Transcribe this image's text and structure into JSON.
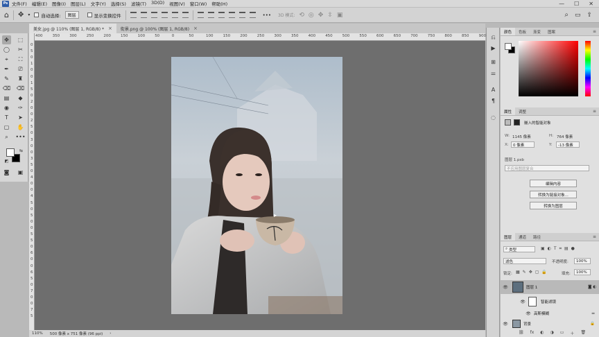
{
  "menubar": {
    "logo": "Ps",
    "items": [
      "文件(F)",
      "编辑(E)",
      "图像(I)",
      "图层(L)",
      "文字(Y)",
      "选择(S)",
      "滤镜(T)",
      "3D(D)",
      "视图(V)",
      "窗口(W)",
      "帮助(H)"
    ],
    "win_min": "—",
    "win_max": "☐",
    "win_close": "✕"
  },
  "options": {
    "home": "⌂",
    "move": "✥",
    "dropdown_arrow": "▾",
    "auto_select_label": "自动选择:",
    "auto_select_value": "图层",
    "show_transform_label": "显示变换控件",
    "more": "•••",
    "mode_3d": "3D 模式:",
    "search_icon": "⌕",
    "workspace_icon": "▭",
    "share_icon": "⇪"
  },
  "tabs": [
    {
      "label": "美女.jpg @ 110% (图层 1, RGB/8) *",
      "close": "×"
    },
    {
      "label": "街景.png @ 100% (图层 1, RGB/8)",
      "close": "×"
    }
  ],
  "hruler": [
    "400",
    "350",
    "300",
    "250",
    "200",
    "150",
    "100",
    "50",
    "0",
    "50",
    "100",
    "150",
    "200",
    "250",
    "300",
    "350",
    "400",
    "450",
    "500",
    "550",
    "600",
    "650",
    "700",
    "750",
    "800",
    "850",
    "900"
  ],
  "vruler": [
    "0",
    "5",
    "0",
    "1",
    "0",
    "0",
    "1",
    "5",
    "0",
    "2",
    "0",
    "0",
    "2",
    "5",
    "0",
    "3",
    "0",
    "0",
    "3",
    "5",
    "0",
    "4",
    "0",
    "0",
    "4",
    "5",
    "0",
    "5",
    "0",
    "0",
    "5",
    "5",
    "0",
    "6",
    "0",
    "0",
    "6",
    "5",
    "0",
    "7",
    "0",
    "0",
    "7",
    "5"
  ],
  "status": {
    "zoom": "110%",
    "docinfo": "500 像素 x 751 像素 (96 ppi)",
    "arrow": "›"
  },
  "color_panel": {
    "tabs": [
      "颜色",
      "色板",
      "渐变",
      "图案"
    ]
  },
  "properties": {
    "tabs": [
      "属性",
      "调整"
    ],
    "type_label": "嵌入的智能对象",
    "w_label": "W:",
    "w_value": "1145 像素",
    "h_label": "H:",
    "h_value": "764 像素",
    "x_label": "X:",
    "x_value": "0 像素",
    "y_label": "Y:",
    "y_value": "-13 像素",
    "file": "图层 1.psb",
    "comp_placeholder": "不应用图层复合",
    "btn_edit": "编辑内容",
    "btn_convert_link": "转换为链接对象...",
    "btn_convert_layer": "转换为图层"
  },
  "layers": {
    "tabs": [
      "图层",
      "通道",
      "路径"
    ],
    "filter_kind": "类型",
    "blend_mode": "滤色",
    "opacity_label": "不透明度:",
    "opacity_value": "100%",
    "lock_label": "锁定:",
    "fill_label": "填充:",
    "fill_value": "100%",
    "items": [
      {
        "name": "图层 1"
      },
      {
        "name": "智能滤镜"
      },
      {
        "name": "高斯模糊"
      },
      {
        "name": "背景"
      }
    ],
    "footer_icons": [
      "⛓",
      "fx",
      "◐",
      "◑",
      "▭",
      "＋",
      "🗑"
    ]
  },
  "toolbar_icons": [
    "✥",
    "⬚",
    "◯",
    "✂",
    "⌖",
    "⛶",
    "✒",
    "⎚",
    "✎",
    "♜",
    "⌫",
    "▤",
    "◆",
    "◉",
    "✑",
    "T",
    "➤",
    "▢",
    "✋",
    "⌕",
    "•••"
  ]
}
